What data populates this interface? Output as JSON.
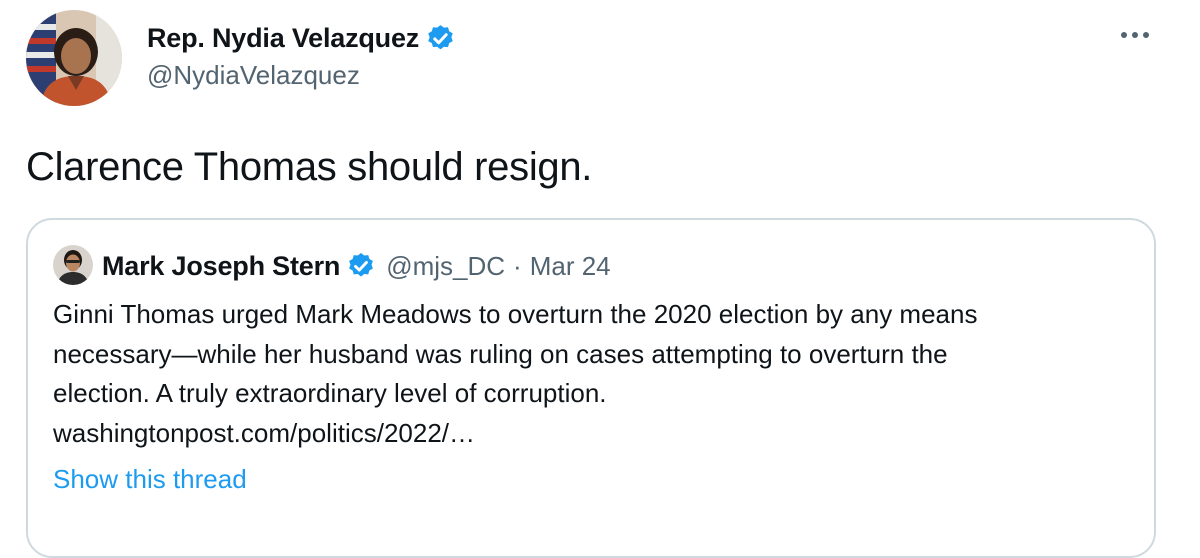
{
  "tweet": {
    "author": {
      "name": "Rep. Nydia Velazquez",
      "handle": "@NydiaVelazquez",
      "verified": true
    },
    "text": "Clarence Thomas should resign.",
    "more_icon": "more-horizontal-icon"
  },
  "quoted_tweet": {
    "author": {
      "name": "Mark Joseph Stern",
      "handle": "@mjs_DC",
      "verified": true
    },
    "separator": "·",
    "date": "Mar 24",
    "text_lines": [
      "Ginni Thomas urged Mark Meadows to overturn the 2020 election by any means",
      "necessary—while her husband was ruling on cases attempting to overturn the",
      "election. A truly extraordinary level of corruption.",
      "washingtonpost.com/politics/2022/…"
    ],
    "thread_link": "Show this thread"
  },
  "colors": {
    "text_primary": "#0f1419",
    "text_secondary": "#536471",
    "accent": "#1d9bf0",
    "border": "#cfd9de"
  }
}
